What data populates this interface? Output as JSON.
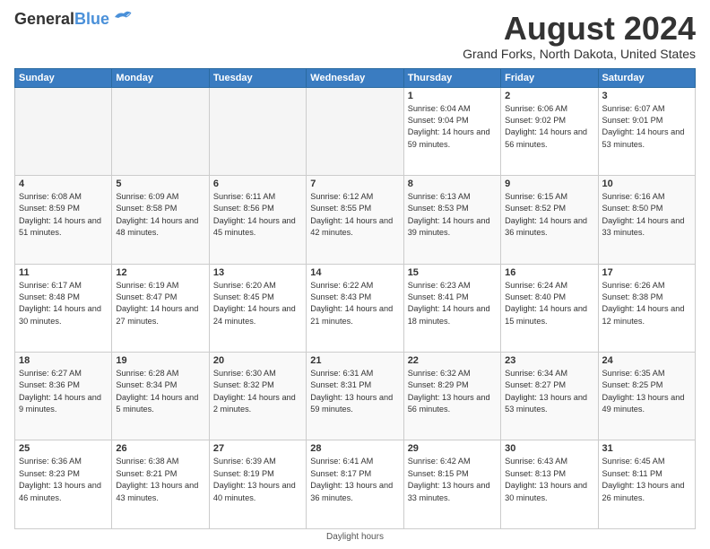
{
  "header": {
    "logo_line1": "General",
    "logo_line2": "Blue",
    "month_year": "August 2024",
    "location": "Grand Forks, North Dakota, United States"
  },
  "days_of_week": [
    "Sunday",
    "Monday",
    "Tuesday",
    "Wednesday",
    "Thursday",
    "Friday",
    "Saturday"
  ],
  "footer": "Daylight hours",
  "weeks": [
    [
      {
        "num": "",
        "empty": true
      },
      {
        "num": "",
        "empty": true
      },
      {
        "num": "",
        "empty": true
      },
      {
        "num": "",
        "empty": true
      },
      {
        "num": "1",
        "sunrise": "6:04 AM",
        "sunset": "9:04 PM",
        "daylight": "14 hours and 59 minutes."
      },
      {
        "num": "2",
        "sunrise": "6:06 AM",
        "sunset": "9:02 PM",
        "daylight": "14 hours and 56 minutes."
      },
      {
        "num": "3",
        "sunrise": "6:07 AM",
        "sunset": "9:01 PM",
        "daylight": "14 hours and 53 minutes."
      }
    ],
    [
      {
        "num": "4",
        "sunrise": "6:08 AM",
        "sunset": "8:59 PM",
        "daylight": "14 hours and 51 minutes."
      },
      {
        "num": "5",
        "sunrise": "6:09 AM",
        "sunset": "8:58 PM",
        "daylight": "14 hours and 48 minutes."
      },
      {
        "num": "6",
        "sunrise": "6:11 AM",
        "sunset": "8:56 PM",
        "daylight": "14 hours and 45 minutes."
      },
      {
        "num": "7",
        "sunrise": "6:12 AM",
        "sunset": "8:55 PM",
        "daylight": "14 hours and 42 minutes."
      },
      {
        "num": "8",
        "sunrise": "6:13 AM",
        "sunset": "8:53 PM",
        "daylight": "14 hours and 39 minutes."
      },
      {
        "num": "9",
        "sunrise": "6:15 AM",
        "sunset": "8:52 PM",
        "daylight": "14 hours and 36 minutes."
      },
      {
        "num": "10",
        "sunrise": "6:16 AM",
        "sunset": "8:50 PM",
        "daylight": "14 hours and 33 minutes."
      }
    ],
    [
      {
        "num": "11",
        "sunrise": "6:17 AM",
        "sunset": "8:48 PM",
        "daylight": "14 hours and 30 minutes."
      },
      {
        "num": "12",
        "sunrise": "6:19 AM",
        "sunset": "8:47 PM",
        "daylight": "14 hours and 27 minutes."
      },
      {
        "num": "13",
        "sunrise": "6:20 AM",
        "sunset": "8:45 PM",
        "daylight": "14 hours and 24 minutes."
      },
      {
        "num": "14",
        "sunrise": "6:22 AM",
        "sunset": "8:43 PM",
        "daylight": "14 hours and 21 minutes."
      },
      {
        "num": "15",
        "sunrise": "6:23 AM",
        "sunset": "8:41 PM",
        "daylight": "14 hours and 18 minutes."
      },
      {
        "num": "16",
        "sunrise": "6:24 AM",
        "sunset": "8:40 PM",
        "daylight": "14 hours and 15 minutes."
      },
      {
        "num": "17",
        "sunrise": "6:26 AM",
        "sunset": "8:38 PM",
        "daylight": "14 hours and 12 minutes."
      }
    ],
    [
      {
        "num": "18",
        "sunrise": "6:27 AM",
        "sunset": "8:36 PM",
        "daylight": "14 hours and 9 minutes."
      },
      {
        "num": "19",
        "sunrise": "6:28 AM",
        "sunset": "8:34 PM",
        "daylight": "14 hours and 5 minutes."
      },
      {
        "num": "20",
        "sunrise": "6:30 AM",
        "sunset": "8:32 PM",
        "daylight": "14 hours and 2 minutes."
      },
      {
        "num": "21",
        "sunrise": "6:31 AM",
        "sunset": "8:31 PM",
        "daylight": "13 hours and 59 minutes."
      },
      {
        "num": "22",
        "sunrise": "6:32 AM",
        "sunset": "8:29 PM",
        "daylight": "13 hours and 56 minutes."
      },
      {
        "num": "23",
        "sunrise": "6:34 AM",
        "sunset": "8:27 PM",
        "daylight": "13 hours and 53 minutes."
      },
      {
        "num": "24",
        "sunrise": "6:35 AM",
        "sunset": "8:25 PM",
        "daylight": "13 hours and 49 minutes."
      }
    ],
    [
      {
        "num": "25",
        "sunrise": "6:36 AM",
        "sunset": "8:23 PM",
        "daylight": "13 hours and 46 minutes."
      },
      {
        "num": "26",
        "sunrise": "6:38 AM",
        "sunset": "8:21 PM",
        "daylight": "13 hours and 43 minutes."
      },
      {
        "num": "27",
        "sunrise": "6:39 AM",
        "sunset": "8:19 PM",
        "daylight": "13 hours and 40 minutes."
      },
      {
        "num": "28",
        "sunrise": "6:41 AM",
        "sunset": "8:17 PM",
        "daylight": "13 hours and 36 minutes."
      },
      {
        "num": "29",
        "sunrise": "6:42 AM",
        "sunset": "8:15 PM",
        "daylight": "13 hours and 33 minutes."
      },
      {
        "num": "30",
        "sunrise": "6:43 AM",
        "sunset": "8:13 PM",
        "daylight": "13 hours and 30 minutes."
      },
      {
        "num": "31",
        "sunrise": "6:45 AM",
        "sunset": "8:11 PM",
        "daylight": "13 hours and 26 minutes."
      }
    ]
  ]
}
